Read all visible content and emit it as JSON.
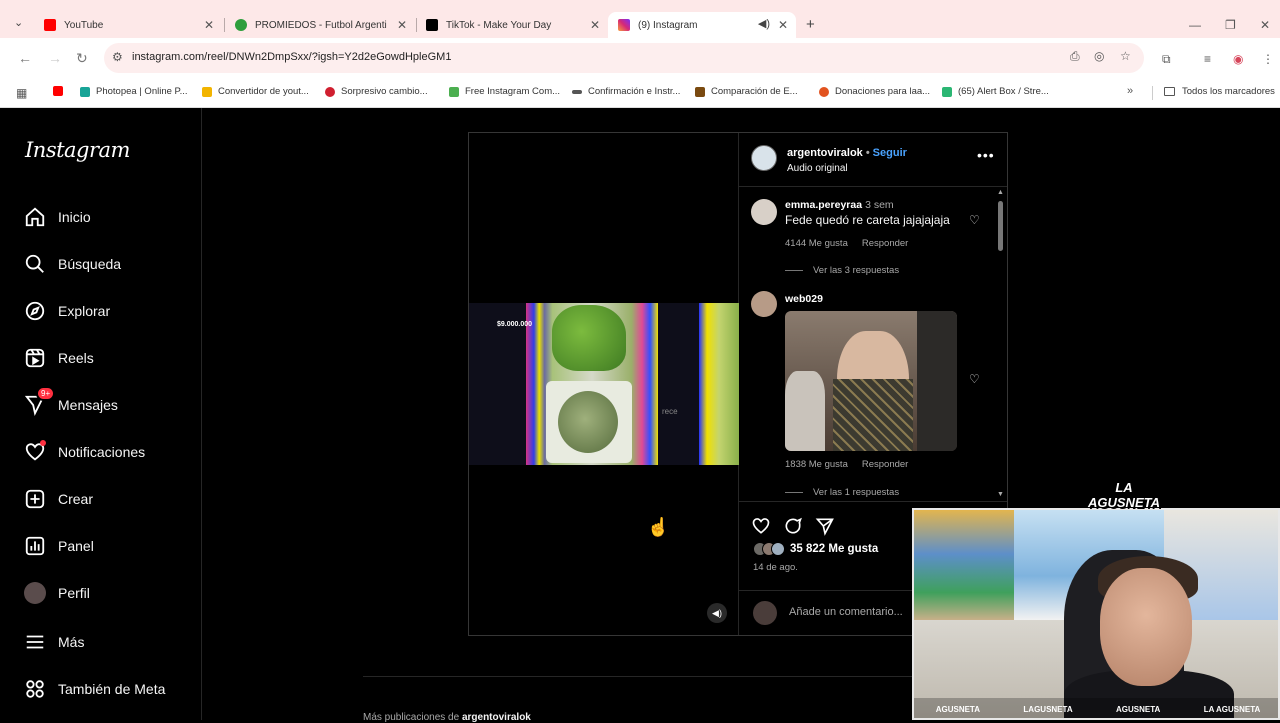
{
  "browser": {
    "tabs": [
      {
        "title": "YouTube",
        "color": "#ff0000"
      },
      {
        "title": "PROMIEDOS - Futbol Argentino",
        "color": "#2e9e3c"
      },
      {
        "title": "TikTok - Make Your Day",
        "color": "#000000"
      },
      {
        "title": "(9) Instagram",
        "color": "#d62976"
      }
    ],
    "url": "instagram.com/reel/DNWn2DmpSxx/?igsh=Y2d2eGowdHpleGM1",
    "bookmarks": [
      {
        "label": "",
        "color": "#ff0000"
      },
      {
        "label": "Photopea | Online P...",
        "color": "#18a497"
      },
      {
        "label": "Convertidor de yout...",
        "color": "#f2b400"
      },
      {
        "label": "Sorpresivo cambio...",
        "color": "#d01f2f"
      },
      {
        "label": "Free Instagram Com...",
        "color": "#4caf50"
      },
      {
        "label": "Confirmación e Instr...",
        "color": "#555555"
      },
      {
        "label": "Comparación de E...",
        "color": "#7a4a10"
      },
      {
        "label": "Donaciones para laa...",
        "color": "#e2531f"
      },
      {
        "label": "(65) Alert Box / Stre...",
        "color": "#2bb673"
      }
    ],
    "bookmarks_folder": "Todos los marcadores"
  },
  "sidebar": {
    "logo": "Instagram",
    "items": [
      {
        "label": "Inicio",
        "icon": "home-icon"
      },
      {
        "label": "Búsqueda",
        "icon": "search-icon"
      },
      {
        "label": "Explorar",
        "icon": "compass-icon"
      },
      {
        "label": "Reels",
        "icon": "reels-icon"
      },
      {
        "label": "Mensajes",
        "icon": "messenger-icon",
        "badge": "9+"
      },
      {
        "label": "Notificaciones",
        "icon": "heart-icon"
      },
      {
        "label": "Crear",
        "icon": "plus-square-icon"
      },
      {
        "label": "Panel",
        "icon": "dashboard-icon"
      },
      {
        "label": "Perfil",
        "icon": "avatar"
      },
      {
        "label": "Más",
        "icon": "menu-icon"
      },
      {
        "label": "También de Meta",
        "icon": "meta-icon"
      }
    ]
  },
  "post": {
    "username": "argentoviralok",
    "follow": "Seguir",
    "audio": "Audio original",
    "video_overlay_amount": "$9.000.000",
    "video_overlay_text": "rece",
    "comments": [
      {
        "user": "emma.pereyraa",
        "time": "3 sem",
        "text": "Fede quedó re careta jajajajaja",
        "likes": "4144 Me gusta",
        "reply": "Responder",
        "replies": "Ver las 3 respuestas"
      },
      {
        "user": "web029",
        "time": "",
        "text": "",
        "likes": "1838 Me gusta",
        "reply": "Responder",
        "replies": "Ver las 1 respuestas"
      }
    ],
    "like_count": "35 822 Me gusta",
    "date": "14 de ago.",
    "comment_placeholder": "Añade un comentario..."
  },
  "more_posts": {
    "prefix": "Más publicaciones de",
    "user": "argentoviralok"
  },
  "overlay": {
    "logo_line1": "LA",
    "logo_line2": "AGUSNETA",
    "socials": [
      "AGUSNETA",
      "LAGUSNETA",
      "AGUSNETA",
      "LA AGUSNETA"
    ]
  }
}
